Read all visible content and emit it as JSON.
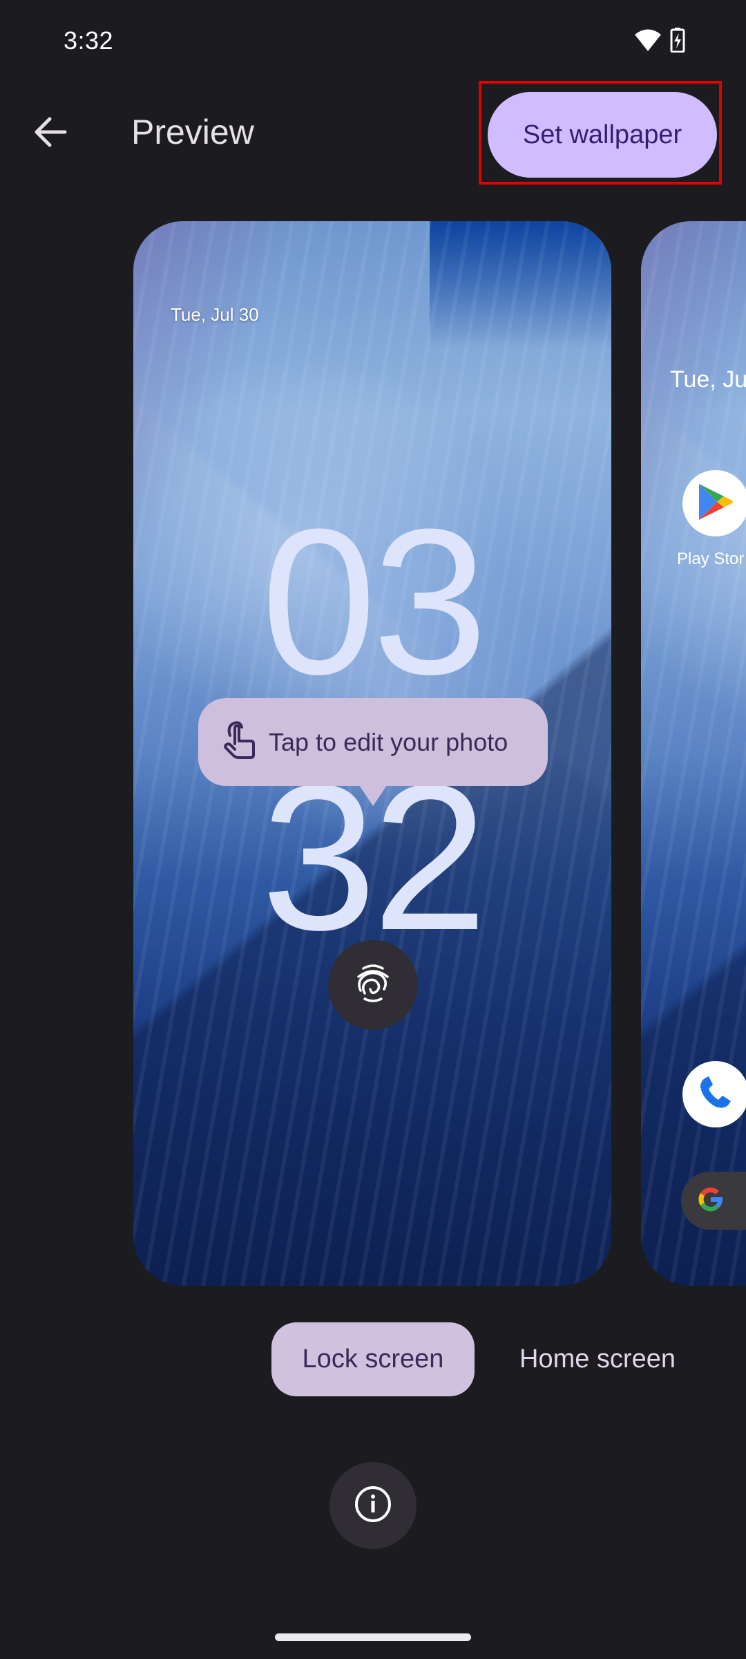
{
  "status_bar": {
    "time": "3:32",
    "icons": [
      "wifi-icon",
      "battery-charging-icon"
    ]
  },
  "top_bar": {
    "back_icon": "arrow-back-icon",
    "title": "Preview",
    "set_wallpaper_label": "Set wallpaper"
  },
  "lock_preview": {
    "date": "Tue, Jul 30",
    "clock_hours": "03",
    "clock_minutes": "32",
    "tooltip_icon": "touch-hand-icon",
    "tooltip_text": "Tap to edit your photo",
    "fingerprint_icon": "fingerprint-icon"
  },
  "home_preview": {
    "date": "Tue, Ju",
    "apps": [
      {
        "label": "Play Stor",
        "icon": "play-store-icon"
      },
      {
        "label": "",
        "icon": "phone-icon"
      }
    ],
    "search_icon": "google-g-icon"
  },
  "tabs": [
    {
      "label": "Lock screen",
      "selected": true
    },
    {
      "label": "Home screen",
      "selected": false
    }
  ],
  "info_icon": "info-icon",
  "colors": {
    "background": "#1c1b1f",
    "primary_button": "#d0bcff",
    "primary_button_text": "#381e72",
    "highlight_outline": "#e00000",
    "selected_tab": "#d0c2de",
    "tooltip_bg": "#cec0dc"
  }
}
